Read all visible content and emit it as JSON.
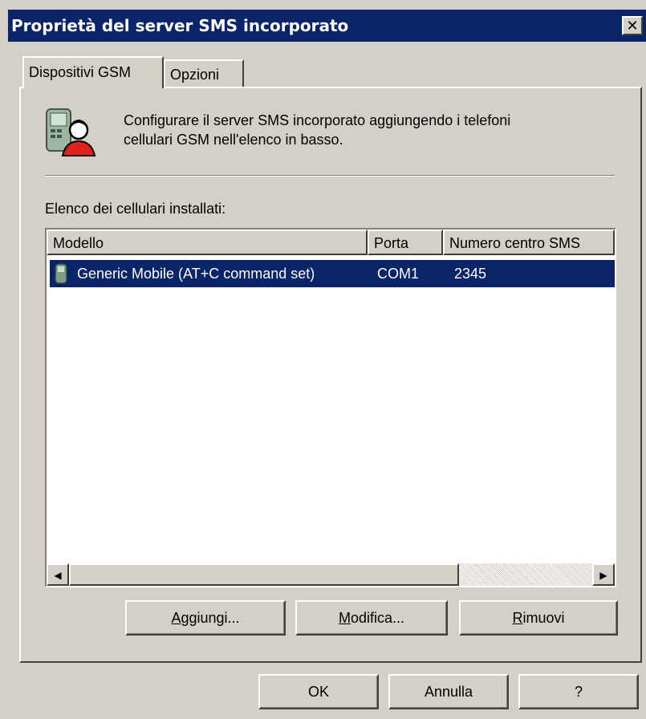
{
  "window": {
    "title": "Proprietà del server SMS incorporato",
    "close_glyph": "✕"
  },
  "tabs": [
    {
      "label": "Dispositivi GSM",
      "active": true
    },
    {
      "label": "Opzioni",
      "active": false
    }
  ],
  "panel": {
    "header_icon": "mobile-user-icon",
    "description_line1": "Configurare il server SMS incorporato aggiungendo i telefoni",
    "description_line2": "cellulari GSM nell'elenco in basso.",
    "list_label": "Elenco dei cellulari installati:"
  },
  "list": {
    "columns": [
      "Modello",
      "Porta",
      "Numero centro SMS"
    ],
    "rows": [
      {
        "icon": "mobile-phone-icon",
        "model": "Generic Mobile (AT+C command set)",
        "port": "COM1",
        "sms_center": "2345",
        "selected": true
      }
    ],
    "scroll_left_glyph": "◀",
    "scroll_right_glyph": "▶"
  },
  "panel_buttons": {
    "add_first": "A",
    "add_rest": "ggiungi...",
    "edit_first": "M",
    "edit_rest": "odifica...",
    "remove_first": "R",
    "remove_rest": "imuovi"
  },
  "dialog_buttons": {
    "ok": "OK",
    "cancel": "Annulla",
    "help": "?"
  },
  "colors": {
    "titlebar": "#0a246a",
    "selection": "#0a246a",
    "face": "#d4d0c8"
  }
}
